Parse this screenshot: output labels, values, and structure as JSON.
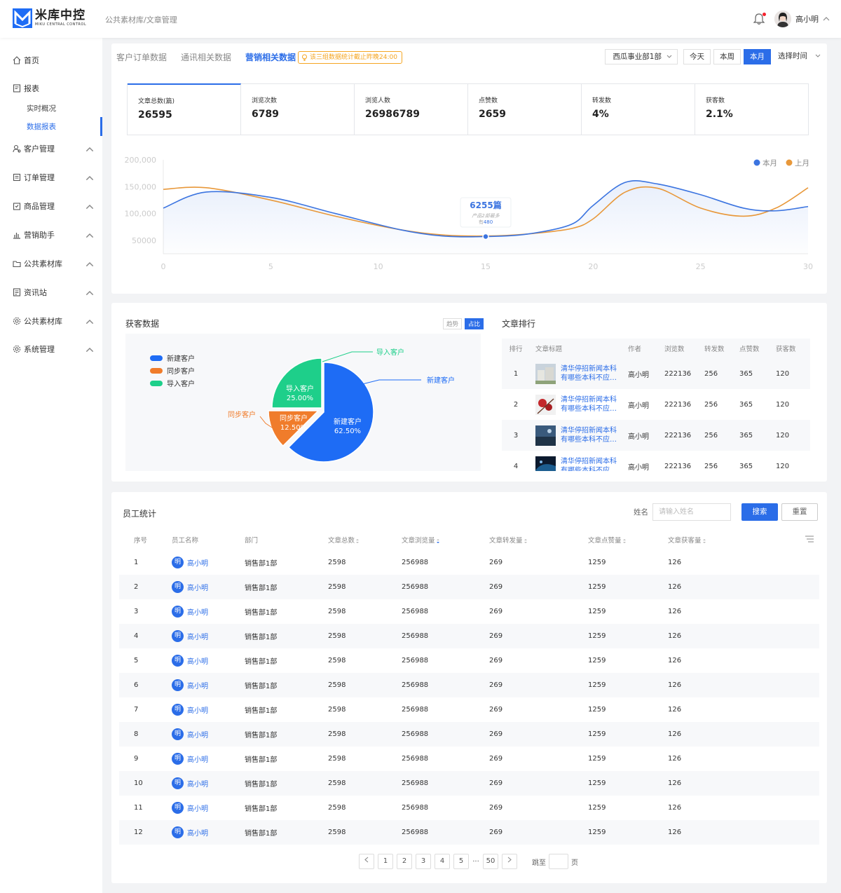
{
  "app": {
    "title": "米库中控",
    "subtitle": "MIKU CENTRAL CONTROL"
  },
  "breadcrumb": "公共素材库/文章管理",
  "user": {
    "name": "高小明"
  },
  "sidebar": {
    "items": [
      {
        "label": "首页",
        "icon": "home-icon"
      },
      {
        "label": "报表",
        "icon": "report-icon"
      },
      {
        "label": "客户管理",
        "icon": "customer-icon"
      },
      {
        "label": "订单管理",
        "icon": "order-icon"
      },
      {
        "label": "商品管理",
        "icon": "goods-icon"
      },
      {
        "label": "营销助手",
        "icon": "chart-icon"
      },
      {
        "label": "公共素材库",
        "icon": "folder-icon"
      },
      {
        "label": "资讯站",
        "icon": "news-icon"
      },
      {
        "label": "公共素材库",
        "icon": "gear-icon"
      },
      {
        "label": "系统管理",
        "icon": "gear-icon"
      }
    ],
    "sub_items": [
      {
        "label": "实时概况",
        "active": false
      },
      {
        "label": "数据报表",
        "active": true
      }
    ]
  },
  "tabs": [
    "客户订单数据",
    "通讯相关数据",
    "营销相关数据"
  ],
  "active_tab": "营销相关数据",
  "notice": "该三组数据统计截止昨晚24:00",
  "filters": {
    "department": "西瓜事业部1部",
    "buttons": [
      "今天",
      "本周",
      "本月"
    ],
    "active": "本月",
    "time_select": "选择时间"
  },
  "stats": [
    {
      "label": "文章总数(篇)",
      "value": "26595"
    },
    {
      "label": "浏览次数",
      "value": "6789"
    },
    {
      "label": "浏览人数",
      "value": "26986789"
    },
    {
      "label": "点赞数",
      "value": "2659"
    },
    {
      "label": "转发数",
      "value": "4%"
    },
    {
      "label": "获客数",
      "value": "2.1%"
    }
  ],
  "chart_data": [
    {
      "type": "line",
      "legend": [
        "本月",
        "上月"
      ],
      "legend_position": "top-right",
      "x_ticks": [
        0,
        5,
        10,
        15,
        20,
        25,
        30
      ],
      "y_ticks": [
        "200,000",
        "150,000",
        "100,000",
        "50000"
      ],
      "ylim": [
        25000,
        200000
      ],
      "xlim": [
        0,
        30
      ],
      "series": [
        {
          "name": "本月",
          "color": "#3b74e0",
          "x": [
            0,
            2,
            5,
            8,
            11,
            13,
            15,
            17,
            19,
            20,
            21.5,
            23,
            25,
            27,
            28.5,
            30
          ],
          "y": [
            110000,
            140000,
            130000,
            100000,
            70000,
            58000,
            57000,
            62000,
            80000,
            115000,
            158000,
            155000,
            135000,
            110000,
            105000,
            113000
          ]
        },
        {
          "name": "上月",
          "color": "#e8983a",
          "x": [
            0,
            2,
            5,
            8,
            11,
            13,
            15,
            17,
            19,
            20,
            21.5,
            23,
            25,
            27,
            28.5,
            30
          ],
          "y": [
            145000,
            148000,
            125000,
            95000,
            70000,
            60000,
            58000,
            62000,
            72000,
            90000,
            140000,
            147000,
            110000,
            95000,
            110000,
            148000
          ]
        }
      ],
      "tooltip": {
        "x": 15,
        "value": "6255篇",
        "line1": "产品2部最多",
        "line2_prefix": "有",
        "line2_value": "480"
      }
    },
    {
      "type": "pie",
      "title": "获客数据",
      "toggle": [
        "趋势",
        "占比"
      ],
      "toggle_active": "占比",
      "slices": [
        {
          "name": "新建客户",
          "value": 62.5,
          "label": "62.50%",
          "color": "#1e6cf5"
        },
        {
          "name": "同步客户",
          "value": 12.5,
          "label": "12.50%",
          "color": "#f07c2b"
        },
        {
          "name": "导入客户",
          "value": 25.0,
          "label": "25.00%",
          "color": "#1ecf8a"
        }
      ]
    }
  ],
  "ranking": {
    "title": "文章排行",
    "headers": [
      "排行",
      "文章标题",
      "作者",
      "浏览数",
      "转发数",
      "点赞数",
      "获客数"
    ],
    "rows": [
      {
        "rank": "1",
        "title": "清华停招新闻本科有哪些本科不应…",
        "author": "高小明",
        "views": "222136",
        "shares": "256",
        "likes": "365",
        "leads": "120"
      },
      {
        "rank": "2",
        "title": "清华停招新闻本科有哪些本科不应…",
        "author": "高小明",
        "views": "222136",
        "shares": "256",
        "likes": "365",
        "leads": "120"
      },
      {
        "rank": "3",
        "title": "清华停招新闻本科有哪些本科不应…",
        "author": "高小明",
        "views": "222136",
        "shares": "256",
        "likes": "365",
        "leads": "120"
      },
      {
        "rank": "4",
        "title": "清华停招新闻本科有哪些本科不应…",
        "author": "高小明",
        "views": "222136",
        "shares": "256",
        "likes": "365",
        "leads": "120"
      }
    ]
  },
  "employees": {
    "title": "员工统计",
    "search_label": "姓名",
    "search_placeholder": "请输入姓名",
    "search_button": "搜索",
    "reset_button": "重置",
    "headers": [
      "序号",
      "员工名称",
      "部门",
      "文章总数",
      "文章浏览量",
      "文章转发量",
      "文章点赞量",
      "文章获客量"
    ],
    "rows": [
      {
        "no": "1",
        "avatar": "明",
        "name": "高小明",
        "dept": "销售部1部",
        "total": "2598",
        "views": "256988",
        "shares": "269",
        "likes": "1259",
        "leads": "126"
      },
      {
        "no": "2",
        "avatar": "明",
        "name": "高小明",
        "dept": "销售部1部",
        "total": "2598",
        "views": "256988",
        "shares": "269",
        "likes": "1259",
        "leads": "126"
      },
      {
        "no": "3",
        "avatar": "明",
        "name": "高小明",
        "dept": "销售部1部",
        "total": "2598",
        "views": "256988",
        "shares": "269",
        "likes": "1259",
        "leads": "126"
      },
      {
        "no": "4",
        "avatar": "明",
        "name": "高小明",
        "dept": "销售部1部",
        "total": "2598",
        "views": "256988",
        "shares": "269",
        "likes": "1259",
        "leads": "126"
      },
      {
        "no": "5",
        "avatar": "明",
        "name": "高小明",
        "dept": "销售部1部",
        "total": "2598",
        "views": "256988",
        "shares": "269",
        "likes": "1259",
        "leads": "126"
      },
      {
        "no": "6",
        "avatar": "明",
        "name": "高小明",
        "dept": "销售部1部",
        "total": "2598",
        "views": "256988",
        "shares": "269",
        "likes": "1259",
        "leads": "126"
      },
      {
        "no": "7",
        "avatar": "明",
        "name": "高小明",
        "dept": "销售部1部",
        "total": "2598",
        "views": "256988",
        "shares": "269",
        "likes": "1259",
        "leads": "126"
      },
      {
        "no": "8",
        "avatar": "明",
        "name": "高小明",
        "dept": "销售部1部",
        "total": "2598",
        "views": "256988",
        "shares": "269",
        "likes": "1259",
        "leads": "126"
      },
      {
        "no": "9",
        "avatar": "明",
        "name": "高小明",
        "dept": "销售部1部",
        "total": "2598",
        "views": "256988",
        "shares": "269",
        "likes": "1259",
        "leads": "126"
      },
      {
        "no": "10",
        "avatar": "明",
        "name": "高小明",
        "dept": "销售部1部",
        "total": "2598",
        "views": "256988",
        "shares": "269",
        "likes": "1259",
        "leads": "126"
      },
      {
        "no": "11",
        "avatar": "明",
        "name": "高小明",
        "dept": "销售部1部",
        "total": "2598",
        "views": "256988",
        "shares": "269",
        "likes": "1259",
        "leads": "126"
      },
      {
        "no": "12",
        "avatar": "明",
        "name": "高小明",
        "dept": "销售部1部",
        "total": "2598",
        "views": "256988",
        "shares": "269",
        "likes": "1259",
        "leads": "126"
      }
    ]
  },
  "pagination": {
    "pages": [
      "1",
      "2",
      "3",
      "4",
      "5",
      "50"
    ],
    "dots": "···",
    "jump_prefix": "跳至",
    "jump_suffix": "页"
  },
  "colors": {
    "primary": "#2b6de8",
    "orange": "#e8983a",
    "green": "#1ecf8a"
  }
}
